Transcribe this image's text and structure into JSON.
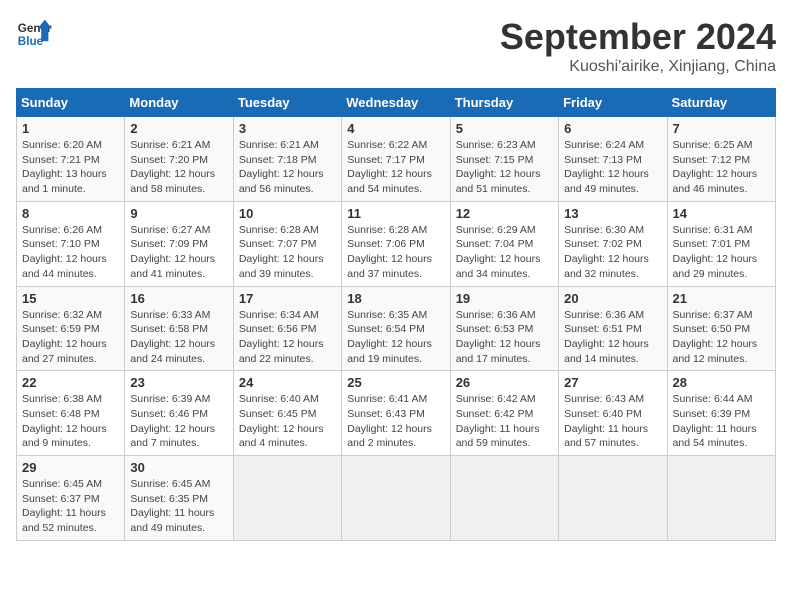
{
  "header": {
    "logo_general": "General",
    "logo_blue": "Blue",
    "month_title": "September 2024",
    "location": "Kuoshi'airike, Xinjiang, China"
  },
  "days_of_week": [
    "Sunday",
    "Monday",
    "Tuesday",
    "Wednesday",
    "Thursday",
    "Friday",
    "Saturday"
  ],
  "weeks": [
    [
      {
        "day": "1",
        "info": "Sunrise: 6:20 AM\nSunset: 7:21 PM\nDaylight: 13 hours\nand 1 minute."
      },
      {
        "day": "2",
        "info": "Sunrise: 6:21 AM\nSunset: 7:20 PM\nDaylight: 12 hours\nand 58 minutes."
      },
      {
        "day": "3",
        "info": "Sunrise: 6:21 AM\nSunset: 7:18 PM\nDaylight: 12 hours\nand 56 minutes."
      },
      {
        "day": "4",
        "info": "Sunrise: 6:22 AM\nSunset: 7:17 PM\nDaylight: 12 hours\nand 54 minutes."
      },
      {
        "day": "5",
        "info": "Sunrise: 6:23 AM\nSunset: 7:15 PM\nDaylight: 12 hours\nand 51 minutes."
      },
      {
        "day": "6",
        "info": "Sunrise: 6:24 AM\nSunset: 7:13 PM\nDaylight: 12 hours\nand 49 minutes."
      },
      {
        "day": "7",
        "info": "Sunrise: 6:25 AM\nSunset: 7:12 PM\nDaylight: 12 hours\nand 46 minutes."
      }
    ],
    [
      {
        "day": "8",
        "info": "Sunrise: 6:26 AM\nSunset: 7:10 PM\nDaylight: 12 hours\nand 44 minutes."
      },
      {
        "day": "9",
        "info": "Sunrise: 6:27 AM\nSunset: 7:09 PM\nDaylight: 12 hours\nand 41 minutes."
      },
      {
        "day": "10",
        "info": "Sunrise: 6:28 AM\nSunset: 7:07 PM\nDaylight: 12 hours\nand 39 minutes."
      },
      {
        "day": "11",
        "info": "Sunrise: 6:28 AM\nSunset: 7:06 PM\nDaylight: 12 hours\nand 37 minutes."
      },
      {
        "day": "12",
        "info": "Sunrise: 6:29 AM\nSunset: 7:04 PM\nDaylight: 12 hours\nand 34 minutes."
      },
      {
        "day": "13",
        "info": "Sunrise: 6:30 AM\nSunset: 7:02 PM\nDaylight: 12 hours\nand 32 minutes."
      },
      {
        "day": "14",
        "info": "Sunrise: 6:31 AM\nSunset: 7:01 PM\nDaylight: 12 hours\nand 29 minutes."
      }
    ],
    [
      {
        "day": "15",
        "info": "Sunrise: 6:32 AM\nSunset: 6:59 PM\nDaylight: 12 hours\nand 27 minutes."
      },
      {
        "day": "16",
        "info": "Sunrise: 6:33 AM\nSunset: 6:58 PM\nDaylight: 12 hours\nand 24 minutes."
      },
      {
        "day": "17",
        "info": "Sunrise: 6:34 AM\nSunset: 6:56 PM\nDaylight: 12 hours\nand 22 minutes."
      },
      {
        "day": "18",
        "info": "Sunrise: 6:35 AM\nSunset: 6:54 PM\nDaylight: 12 hours\nand 19 minutes."
      },
      {
        "day": "19",
        "info": "Sunrise: 6:36 AM\nSunset: 6:53 PM\nDaylight: 12 hours\nand 17 minutes."
      },
      {
        "day": "20",
        "info": "Sunrise: 6:36 AM\nSunset: 6:51 PM\nDaylight: 12 hours\nand 14 minutes."
      },
      {
        "day": "21",
        "info": "Sunrise: 6:37 AM\nSunset: 6:50 PM\nDaylight: 12 hours\nand 12 minutes."
      }
    ],
    [
      {
        "day": "22",
        "info": "Sunrise: 6:38 AM\nSunset: 6:48 PM\nDaylight: 12 hours\nand 9 minutes."
      },
      {
        "day": "23",
        "info": "Sunrise: 6:39 AM\nSunset: 6:46 PM\nDaylight: 12 hours\nand 7 minutes."
      },
      {
        "day": "24",
        "info": "Sunrise: 6:40 AM\nSunset: 6:45 PM\nDaylight: 12 hours\nand 4 minutes."
      },
      {
        "day": "25",
        "info": "Sunrise: 6:41 AM\nSunset: 6:43 PM\nDaylight: 12 hours\nand 2 minutes."
      },
      {
        "day": "26",
        "info": "Sunrise: 6:42 AM\nSunset: 6:42 PM\nDaylight: 11 hours\nand 59 minutes."
      },
      {
        "day": "27",
        "info": "Sunrise: 6:43 AM\nSunset: 6:40 PM\nDaylight: 11 hours\nand 57 minutes."
      },
      {
        "day": "28",
        "info": "Sunrise: 6:44 AM\nSunset: 6:39 PM\nDaylight: 11 hours\nand 54 minutes."
      }
    ],
    [
      {
        "day": "29",
        "info": "Sunrise: 6:45 AM\nSunset: 6:37 PM\nDaylight: 11 hours\nand 52 minutes."
      },
      {
        "day": "30",
        "info": "Sunrise: 6:45 AM\nSunset: 6:35 PM\nDaylight: 11 hours\nand 49 minutes."
      },
      {
        "day": "",
        "info": ""
      },
      {
        "day": "",
        "info": ""
      },
      {
        "day": "",
        "info": ""
      },
      {
        "day": "",
        "info": ""
      },
      {
        "day": "",
        "info": ""
      }
    ]
  ]
}
